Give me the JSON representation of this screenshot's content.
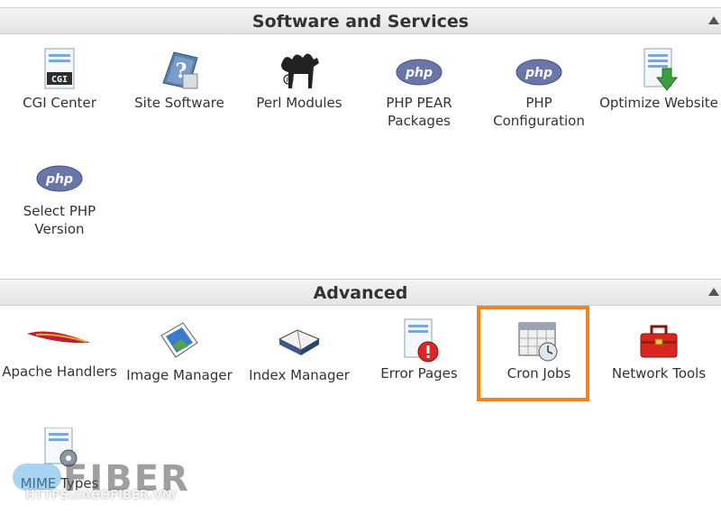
{
  "sections": [
    {
      "title": "Software and Services",
      "items": [
        {
          "label": "CGI Center",
          "icon": "cgi-icon"
        },
        {
          "label": "Site Software",
          "icon": "site-software-icon"
        },
        {
          "label": "Perl Modules",
          "icon": "camel-icon"
        },
        {
          "label": "PHP PEAR Packages",
          "icon": "php-icon"
        },
        {
          "label": "PHP Configuration",
          "icon": "php-icon"
        },
        {
          "label": "Optimize Website",
          "icon": "optimize-icon"
        },
        {
          "label": "Select PHP Version",
          "icon": "php-icon"
        }
      ]
    },
    {
      "title": "Advanced",
      "items": [
        {
          "label": "Apache Handlers",
          "icon": "feather-icon"
        },
        {
          "label": "Image Manager",
          "icon": "image-icon"
        },
        {
          "label": "Index Manager",
          "icon": "book-icon"
        },
        {
          "label": "Error Pages",
          "icon": "error-page-icon"
        },
        {
          "label": "Cron Jobs",
          "icon": "calendar-clock-icon"
        },
        {
          "label": "Network Tools",
          "icon": "toolbox-icon"
        },
        {
          "label": "MIME Types",
          "icon": "mime-icon"
        }
      ]
    }
  ],
  "icon_text": {
    "cgi": "CGI",
    "php": "php"
  },
  "watermark": {
    "logo": "FIBER",
    "url": "HTTPS://AGOFIBER.VN/"
  },
  "colors": {
    "highlight": "#f58220",
    "php_badge": "#6a76a8",
    "header_bg": "#ececec"
  }
}
